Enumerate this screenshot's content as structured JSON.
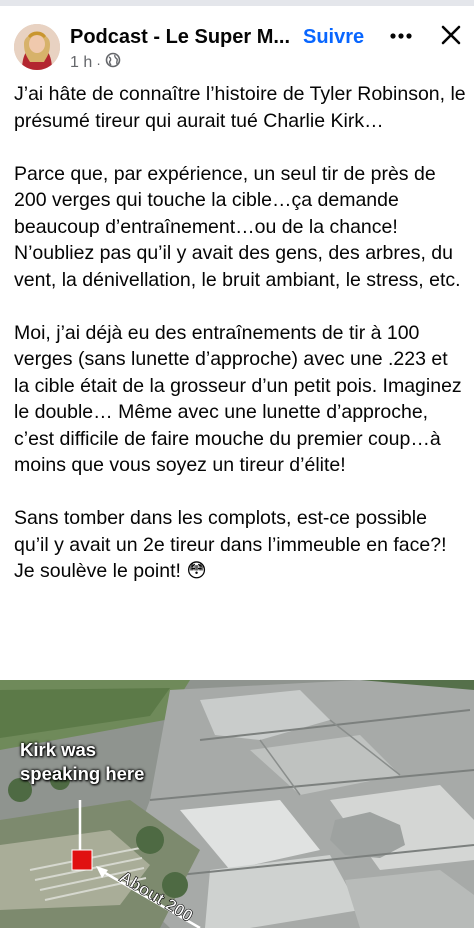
{
  "post": {
    "author_name": "Podcast - Le Super M...",
    "follow_label": "Suivre",
    "time": "1 h",
    "privacy_icon": "globe-icon",
    "more_icon": "more-horizontal-icon",
    "close_icon": "close-icon",
    "paragraphs": [
      "J’ai hâte de connaître l’histoire de Tyler Robinson, le présumé tireur qui aurait tué Charlie Kirk…",
      "Parce que, par expérience, un seul tir de près de 200 verges qui touche la cible…ça demande beaucoup d’entraînement…ou de la chance! N’oubliez pas qu’il y avait des gens, des arbres, du vent, la dénivellation, le bruit ambiant, le stress, etc.",
      "Moi, j’ai déjà eu des entraînements de tir à 100 verges (sans lunette d’approche) avec une .223 et la cible était de la grosseur d’un petit pois. Imaginez le double… Même avec une lunette d’approche, c’est difficile de faire mouche du premier coup…à moins que vous soyez un tireur d’élite!",
      "Sans tomber dans les complots, est-ce possible qu’il y avait un 2e tireur dans l’immeuble en face?! Je soulève le point! 😳"
    ]
  },
  "photo": {
    "label_line1": "Kirk was",
    "label_line2": "speaking here",
    "distance_label": "About 200"
  },
  "colors": {
    "follow": "#0866ff",
    "meta": "#65676b",
    "marker": "#e01010"
  }
}
